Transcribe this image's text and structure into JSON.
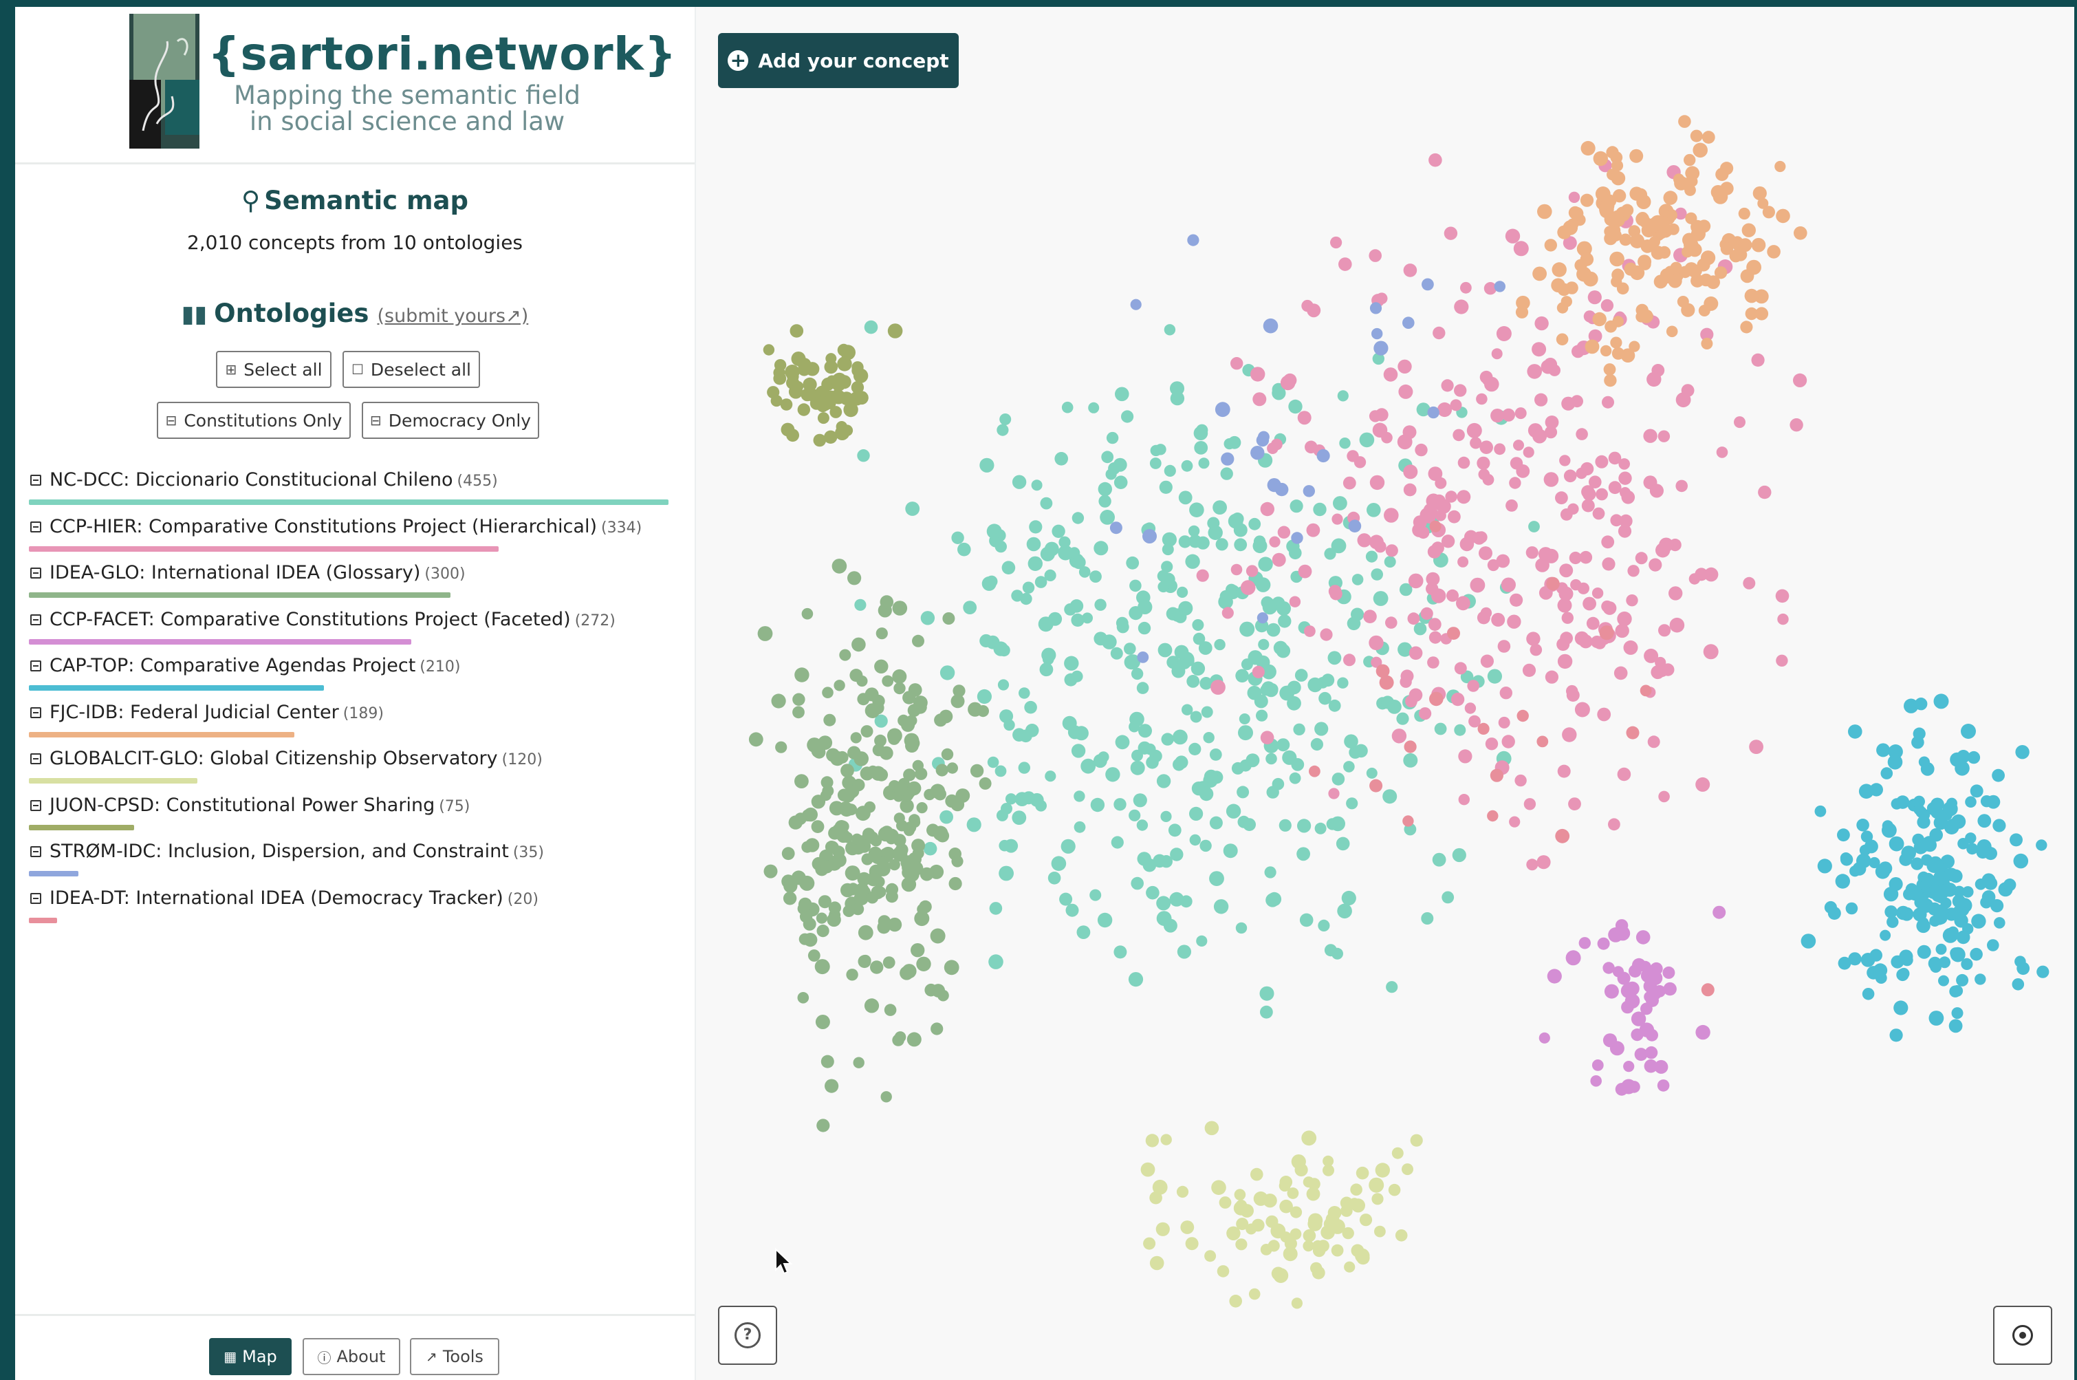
{
  "brand": {
    "title": "{sartori.network}",
    "tagline_line1": "Mapping the semantic field",
    "tagline_line2": "in social science and law"
  },
  "semantic_map": {
    "title": "Semantic map",
    "icon": "graph-icon",
    "concept_count": "2,010 concepts from 10 ontologies"
  },
  "ontologies": {
    "title": "Ontologies",
    "icon": "books-icon",
    "submit_link": "(submit yours↗)",
    "buttons": {
      "select_all": "Select all",
      "deselect_all": "Deselect all",
      "constitutions_only": "Constitutions Only",
      "democracy_only": "Democracy Only"
    },
    "items": [
      {
        "label": "NC-DCC: Diccionario Constitucional Chileno",
        "count": "(455)",
        "color": "#7fd3be",
        "value": 455
      },
      {
        "label": "CCP-HIER: Comparative Constitutions Project (Hierarchical)",
        "count": "(334)",
        "color": "#e895b6",
        "value": 334
      },
      {
        "label": "IDEA-GLO: International IDEA (Glossary)",
        "count": "(300)",
        "color": "#8fb58a",
        "value": 300
      },
      {
        "label": "CCP-FACET: Comparative Constitutions Project (Faceted)",
        "count": "(272)",
        "color": "#d48ed4",
        "value": 272
      },
      {
        "label": "CAP-TOP: Comparative Agendas Project",
        "count": "(210)",
        "color": "#4cbdd3",
        "value": 210
      },
      {
        "label": "FJC-IDB: Federal Judicial Center",
        "count": "(189)",
        "color": "#edb184",
        "value": 189
      },
      {
        "label": "GLOBALCIT-GLO: Global Citizenship Observatory",
        "count": "(120)",
        "color": "#d8e0a2",
        "value": 120
      },
      {
        "label": "JUON-CPSD: Constitutional Power Sharing",
        "count": "(75)",
        "color": "#9fac66",
        "value": 75
      },
      {
        "label": "STRØM-IDC: Inclusion, Dispersion, and Constraint",
        "count": "(35)",
        "color": "#8fa6dd",
        "value": 35
      },
      {
        "label": "IDEA-DT: International IDEA (Democracy Tracker)",
        "count": "(20)",
        "color": "#e88f9b",
        "value": 20
      }
    ]
  },
  "nav": {
    "map": "Map",
    "about": "About",
    "tools": "Tools"
  },
  "map": {
    "add_concept": "Add your concept",
    "help_icon": "help-icon",
    "recenter_icon": "recenter-icon"
  }
}
